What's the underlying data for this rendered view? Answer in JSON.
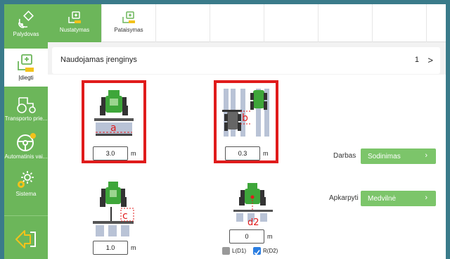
{
  "sidebar": {
    "items": [
      {
        "label": "Palydovas",
        "icon": "satellite-icon"
      },
      {
        "label": "Įdiegti",
        "icon": "install-icon",
        "active": true
      },
      {
        "label": "Transporto prie...",
        "icon": "tractor-icon"
      },
      {
        "label": "Automatinis vai...",
        "icon": "steering-wheel-icon"
      },
      {
        "label": "Sistema",
        "icon": "gear-icon"
      }
    ],
    "back_icon": "back-arrow-icon"
  },
  "tabs": [
    {
      "label": "Nustatymas",
      "active": true
    },
    {
      "label": "Pataisymas",
      "active": false
    }
  ],
  "header": {
    "title": "Naudojamas įrenginys",
    "page": "1",
    "chevron": ">"
  },
  "implements": {
    "a": {
      "marker": "a",
      "value": "3.0",
      "unit": "m"
    },
    "b": {
      "marker": "b",
      "value": "0.3",
      "unit": "m"
    },
    "c": {
      "marker": "c",
      "value": "1.0",
      "unit": "m"
    },
    "d2": {
      "marker": "d2",
      "value": "0",
      "unit": "m"
    }
  },
  "checkboxes": {
    "left": {
      "label": "L(D1)",
      "checked": false
    },
    "right": {
      "label": "R(D2)",
      "checked": true
    }
  },
  "settings": {
    "darbas": {
      "label": "Darbas",
      "value": "Sodinimas"
    },
    "apkarpyti": {
      "label": "Apkarpyti",
      "value": "Medvilnė"
    }
  },
  "colors": {
    "accent_green": "#6cb65a",
    "button_green": "#7cc56a",
    "highlight_red": "#e01b1b",
    "check_blue": "#2a7de1"
  }
}
